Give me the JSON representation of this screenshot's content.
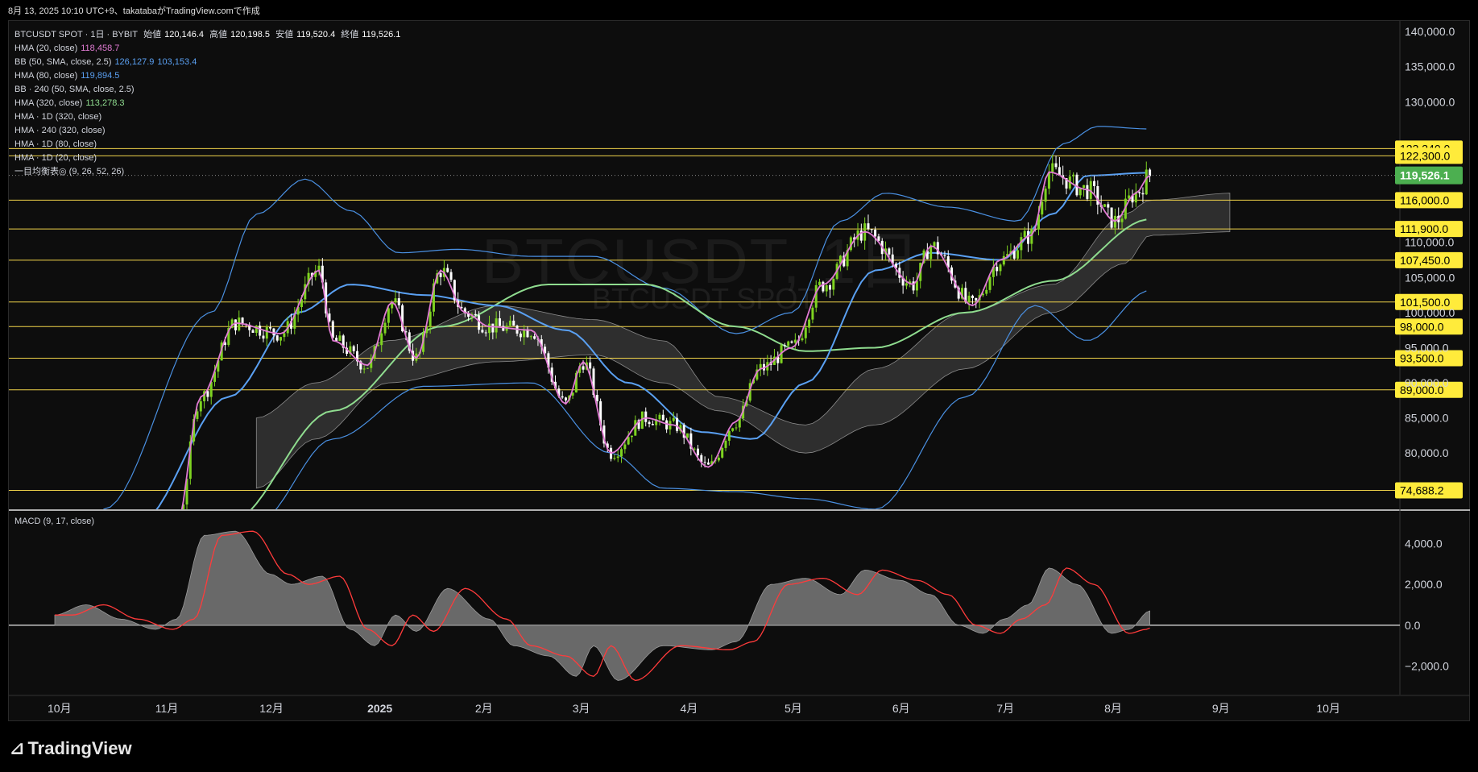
{
  "caption": "8月 13, 2025 10:10 UTC+9、takatabaがTradingView.comで作成",
  "legend": {
    "title": "BTCUSDT SPOT · 1日 · BYBIT",
    "ohlc": {
      "open_label": "始値",
      "open": "120,146.4",
      "high_label": "高値",
      "high": "120,198.5",
      "low_label": "安値",
      "low": "119,520.4",
      "close_label": "終値",
      "close": "119,526.1"
    },
    "indicators": [
      {
        "name": "HMA (20, close)",
        "values": [
          "118,458.7"
        ],
        "color": "#e17bd3"
      },
      {
        "name": "BB (50, SMA, close, 2.5)",
        "values": [
          "126,127.9",
          "103,153.4"
        ],
        "color": "#5aa0f2"
      },
      {
        "name": "HMA (80, close)",
        "values": [
          "119,894.5"
        ],
        "color": "#5aa0f2"
      },
      {
        "name": "BB · 240 (50, SMA, close, 2.5)",
        "values": [],
        "color": "#d1d4dc"
      },
      {
        "name": "HMA (320, close)",
        "values": [
          "113,278.3"
        ],
        "color": "#8fdc8f"
      },
      {
        "name": "HMA · 1D (320, close)",
        "values": [],
        "color": "#d1d4dc"
      },
      {
        "name": "HMA · 240 (320, close)",
        "values": [],
        "color": "#d1d4dc"
      },
      {
        "name": "HMA · 1D (80, close)",
        "values": [],
        "color": "#d1d4dc"
      },
      {
        "name": "HMA · 1D (20, close)",
        "values": [],
        "color": "#d1d4dc"
      },
      {
        "name": "一目均衡表◎ (9, 26, 52, 26)",
        "values": [],
        "color": "#d1d4dc"
      }
    ]
  },
  "watermark": {
    "main": "BTCUSDT, 1日",
    "sub": "BTCUSDT SPOT"
  },
  "macd_label": "MACD (9, 17, close)",
  "brand": "TradingView",
  "colors": {
    "candle_up": "#7ed321",
    "candle_down": "#ffffff",
    "level_line": "#f0d34a",
    "label_bg": "#ffeb3b",
    "price_bg": "#4caf50",
    "hma20": "#e17bd3",
    "bb": "#4a90e2",
    "hma80": "#5aa0f2",
    "hma320": "#8fdc8f",
    "macd_signal": "#ff3b3b",
    "cloud": "#3a3a3a"
  },
  "chart_data": {
    "type": "candlestick",
    "symbol": "BTCUSDT SPOT",
    "interval": "1日",
    "exchange": "BYBIT",
    "y_axis_ticks": [
      "140,000.0",
      "135,000.0",
      "130,000.0",
      "110,000.0",
      "105,000.0",
      "100,000.0",
      "95,000.0",
      "90,000.0",
      "85,000.0",
      "80,000.0"
    ],
    "ylim": [
      72000,
      141500
    ],
    "x_axis_labels": [
      "10月",
      "11月",
      "12月",
      "2025",
      "2月",
      "3月",
      "4月",
      "5月",
      "6月",
      "7月",
      "8月",
      "9月",
      "10月"
    ],
    "horizontal_levels": [
      {
        "value": 123340.0,
        "label": "123,340.0"
      },
      {
        "value": 122300.0,
        "label": "122,300.0"
      },
      {
        "value": 116000.0,
        "label": "116,000.0"
      },
      {
        "value": 111900.0,
        "label": "111,900.0"
      },
      {
        "value": 107450.0,
        "label": "107,450.0"
      },
      {
        "value": 101500.0,
        "label": "101,500.0"
      },
      {
        "value": 98000.0,
        "label": "98,000.0"
      },
      {
        "value": 93500.0,
        "label": "93,500.0"
      },
      {
        "value": 89000.0,
        "label": "89,000.0"
      },
      {
        "value": 74688.2,
        "label": "74,688.2"
      }
    ],
    "last_price": {
      "value": 119526.1,
      "label": "119,526.1"
    },
    "close_anchors": [
      {
        "date": "2024-10-15",
        "close": 68000
      },
      {
        "date": "2024-11-05",
        "close": 69500
      },
      {
        "date": "2024-11-12",
        "close": 88000
      },
      {
        "date": "2024-11-22",
        "close": 98500
      },
      {
        "date": "2024-12-05",
        "close": 97000
      },
      {
        "date": "2024-12-16",
        "close": 106000
      },
      {
        "date": "2024-12-20",
        "close": 96000
      },
      {
        "date": "2024-12-30",
        "close": 92500
      },
      {
        "date": "2025-01-06",
        "close": 101500
      },
      {
        "date": "2025-01-13",
        "close": 93500
      },
      {
        "date": "2025-01-20",
        "close": 106000
      },
      {
        "date": "2025-01-27",
        "close": 100000
      },
      {
        "date": "2025-02-03",
        "close": 98000
      },
      {
        "date": "2025-02-15",
        "close": 97500
      },
      {
        "date": "2025-02-25",
        "close": 87000
      },
      {
        "date": "2025-03-02",
        "close": 93000
      },
      {
        "date": "2025-03-10",
        "close": 80000
      },
      {
        "date": "2025-03-20",
        "close": 85000
      },
      {
        "date": "2025-03-28",
        "close": 84000
      },
      {
        "date": "2025-04-07",
        "close": 78000
      },
      {
        "date": "2025-04-15",
        "close": 84500
      },
      {
        "date": "2025-04-22",
        "close": 92000
      },
      {
        "date": "2025-05-01",
        "close": 95000
      },
      {
        "date": "2025-05-10",
        "close": 104000
      },
      {
        "date": "2025-05-22",
        "close": 111500
      },
      {
        "date": "2025-06-05",
        "close": 104000
      },
      {
        "date": "2025-06-10",
        "close": 109500
      },
      {
        "date": "2025-06-22",
        "close": 101000
      },
      {
        "date": "2025-06-30",
        "close": 107500
      },
      {
        "date": "2025-07-09",
        "close": 111000
      },
      {
        "date": "2025-07-14",
        "close": 120000
      },
      {
        "date": "2025-07-25",
        "close": 117500
      },
      {
        "date": "2025-08-02",
        "close": 113000
      },
      {
        "date": "2025-08-08",
        "close": 117000
      },
      {
        "date": "2025-08-12",
        "close": 119526
      }
    ],
    "bb_upper_anchors": [
      {
        "date": "2024-10-15",
        "v": 72000
      },
      {
        "date": "2024-11-15",
        "v": 100000
      },
      {
        "date": "2024-11-28",
        "v": 114000
      },
      {
        "date": "2024-12-12",
        "v": 119000
      },
      {
        "date": "2024-12-25",
        "v": 114500
      },
      {
        "date": "2025-01-08",
        "v": 108500
      },
      {
        "date": "2025-01-25",
        "v": 109000
      },
      {
        "date": "2025-02-15",
        "v": 108000
      },
      {
        "date": "2025-03-05",
        "v": 108000
      },
      {
        "date": "2025-03-25",
        "v": 103500
      },
      {
        "date": "2025-04-15",
        "v": 97000
      },
      {
        "date": "2025-05-01",
        "v": 100000
      },
      {
        "date": "2025-05-15",
        "v": 113000
      },
      {
        "date": "2025-05-28",
        "v": 117000
      },
      {
        "date": "2025-06-15",
        "v": 115000
      },
      {
        "date": "2025-07-05",
        "v": 113000
      },
      {
        "date": "2025-07-18",
        "v": 124000
      },
      {
        "date": "2025-07-28",
        "v": 126500
      },
      {
        "date": "2025-08-12",
        "v": 126127
      }
    ],
    "bb_lower_anchors": [
      {
        "date": "2024-10-15",
        "v": 55000
      },
      {
        "date": "2024-11-28",
        "v": 70000
      },
      {
        "date": "2024-12-20",
        "v": 82000
      },
      {
        "date": "2025-01-15",
        "v": 89500
      },
      {
        "date": "2025-02-15",
        "v": 90000
      },
      {
        "date": "2025-03-10",
        "v": 80000
      },
      {
        "date": "2025-03-25",
        "v": 75000
      },
      {
        "date": "2025-04-15",
        "v": 74500
      },
      {
        "date": "2025-05-05",
        "v": 73500
      },
      {
        "date": "2025-05-25",
        "v": 72000
      },
      {
        "date": "2025-06-20",
        "v": 88000
      },
      {
        "date": "2025-07-10",
        "v": 101000
      },
      {
        "date": "2025-07-25",
        "v": 96000
      },
      {
        "date": "2025-08-12",
        "v": 103153
      }
    ],
    "hma80_anchors": [
      {
        "date": "2024-10-25",
        "v": 70000
      },
      {
        "date": "2024-11-20",
        "v": 88000
      },
      {
        "date": "2024-12-10",
        "v": 100000
      },
      {
        "date": "2024-12-25",
        "v": 104000
      },
      {
        "date": "2025-01-15",
        "v": 102500
      },
      {
        "date": "2025-02-05",
        "v": 101000
      },
      {
        "date": "2025-02-25",
        "v": 97500
      },
      {
        "date": "2025-03-15",
        "v": 90000
      },
      {
        "date": "2025-04-05",
        "v": 83000
      },
      {
        "date": "2025-04-20",
        "v": 82000
      },
      {
        "date": "2025-05-05",
        "v": 90000
      },
      {
        "date": "2025-05-25",
        "v": 106000
      },
      {
        "date": "2025-06-10",
        "v": 108500
      },
      {
        "date": "2025-06-30",
        "v": 107500
      },
      {
        "date": "2025-07-15",
        "v": 114000
      },
      {
        "date": "2025-07-25",
        "v": 119500
      },
      {
        "date": "2025-08-12",
        "v": 119894
      }
    ],
    "hma320_anchors": [
      {
        "date": "2024-11-20",
        "v": 70000
      },
      {
        "date": "2024-12-20",
        "v": 86000
      },
      {
        "date": "2025-01-20",
        "v": 98000
      },
      {
        "date": "2025-02-20",
        "v": 104000
      },
      {
        "date": "2025-03-20",
        "v": 104000
      },
      {
        "date": "2025-04-15",
        "v": 98000
      },
      {
        "date": "2025-05-05",
        "v": 94500
      },
      {
        "date": "2025-05-25",
        "v": 95000
      },
      {
        "date": "2025-06-20",
        "v": 100000
      },
      {
        "date": "2025-07-15",
        "v": 104500
      },
      {
        "date": "2025-08-12",
        "v": 113278
      }
    ],
    "cloud_upper_anchors": [
      {
        "date": "2024-11-28",
        "v": 85000
      },
      {
        "date": "2024-12-15",
        "v": 90000
      },
      {
        "date": "2025-01-05",
        "v": 96000
      },
      {
        "date": "2025-02-05",
        "v": 101000
      },
      {
        "date": "2025-03-05",
        "v": 99000
      },
      {
        "date": "2025-03-25",
        "v": 96000
      },
      {
        "date": "2025-04-10",
        "v": 88000
      },
      {
        "date": "2025-05-05",
        "v": 84000
      },
      {
        "date": "2025-05-25",
        "v": 92000
      },
      {
        "date": "2025-06-20",
        "v": 100000
      },
      {
        "date": "2025-07-15",
        "v": 104000
      },
      {
        "date": "2025-08-05",
        "v": 114000
      },
      {
        "date": "2025-08-12",
        "v": 116000
      },
      {
        "date": "2025-09-05",
        "v": 117000
      }
    ],
    "cloud_lower_anchors": [
      {
        "date": "2024-11-28",
        "v": 75000
      },
      {
        "date": "2024-12-15",
        "v": 82000
      },
      {
        "date": "2025-01-05",
        "v": 90000
      },
      {
        "date": "2025-02-05",
        "v": 93000
      },
      {
        "date": "2025-03-05",
        "v": 94000
      },
      {
        "date": "2025-03-25",
        "v": 90000
      },
      {
        "date": "2025-04-10",
        "v": 86000
      },
      {
        "date": "2025-05-05",
        "v": 80000
      },
      {
        "date": "2025-05-25",
        "v": 84000
      },
      {
        "date": "2025-06-20",
        "v": 92000
      },
      {
        "date": "2025-07-15",
        "v": 100000
      },
      {
        "date": "2025-08-05",
        "v": 107000
      },
      {
        "date": "2025-08-12",
        "v": 111000
      },
      {
        "date": "2025-09-05",
        "v": 111500
      }
    ],
    "macd": {
      "y_axis_ticks": [
        "4,000.0",
        "2,000.0",
        "0.0",
        "−2,000.0"
      ],
      "ylim": [
        -3000,
        5200
      ],
      "anchors": [
        {
          "date": "2024-10-01",
          "v": 500
        },
        {
          "date": "2024-10-10",
          "v": 1000
        },
        {
          "date": "2024-10-20",
          "v": 300
        },
        {
          "date": "2024-10-30",
          "v": -200
        },
        {
          "date": "2024-11-05",
          "v": 300
        },
        {
          "date": "2024-11-13",
          "v": 4400
        },
        {
          "date": "2024-11-22",
          "v": 4600
        },
        {
          "date": "2024-12-02",
          "v": 2500
        },
        {
          "date": "2024-12-08",
          "v": 2000
        },
        {
          "date": "2024-12-17",
          "v": 2400
        },
        {
          "date": "2024-12-25",
          "v": -200
        },
        {
          "date": "2025-01-01",
          "v": -1000
        },
        {
          "date": "2025-01-07",
          "v": 500
        },
        {
          "date": "2025-01-13",
          "v": -300
        },
        {
          "date": "2025-01-22",
          "v": 1800
        },
        {
          "date": "2025-02-03",
          "v": 300
        },
        {
          "date": "2025-02-10",
          "v": -1000
        },
        {
          "date": "2025-02-20",
          "v": -1500
        },
        {
          "date": "2025-02-28",
          "v": -2500
        },
        {
          "date": "2025-03-05",
          "v": -1000
        },
        {
          "date": "2025-03-12",
          "v": -2700
        },
        {
          "date": "2025-03-25",
          "v": -1000
        },
        {
          "date": "2025-04-08",
          "v": -1200
        },
        {
          "date": "2025-04-15",
          "v": -800
        },
        {
          "date": "2025-04-25",
          "v": 2000
        },
        {
          "date": "2025-05-05",
          "v": 2300
        },
        {
          "date": "2025-05-15",
          "v": 1500
        },
        {
          "date": "2025-05-22",
          "v": 2700
        },
        {
          "date": "2025-06-01",
          "v": 2200
        },
        {
          "date": "2025-06-10",
          "v": 1500
        },
        {
          "date": "2025-06-18",
          "v": 0
        },
        {
          "date": "2025-06-25",
          "v": -400
        },
        {
          "date": "2025-07-01",
          "v": 300
        },
        {
          "date": "2025-07-08",
          "v": 1000
        },
        {
          "date": "2025-07-14",
          "v": 2800
        },
        {
          "date": "2025-07-22",
          "v": 2000
        },
        {
          "date": "2025-08-01",
          "v": -400
        },
        {
          "date": "2025-08-06",
          "v": -200
        },
        {
          "date": "2025-08-12",
          "v": 700
        }
      ]
    }
  }
}
